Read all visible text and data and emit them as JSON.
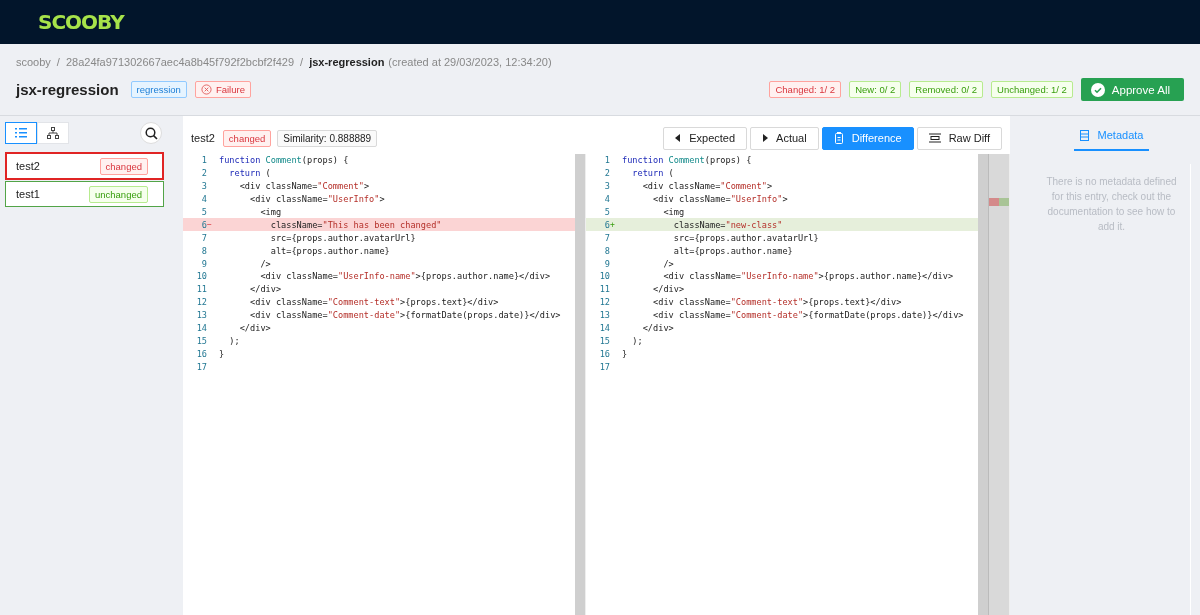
{
  "logo": "SCOOBY",
  "breadcrumb": {
    "separator": "/",
    "items": [
      "scooby",
      "28a24fa971302667aec4a8b45f792f2bcbf2f429",
      "jsx-regression"
    ],
    "created": "(created at 29/03/2023, 12:34:20)"
  },
  "title": "jsx-regression",
  "type_tag": "regression",
  "status_tag": "Failure",
  "counters": [
    {
      "kind": "changed",
      "label": "Changed: 1/ 2"
    },
    {
      "kind": "other",
      "label": "New: 0/ 2"
    },
    {
      "kind": "other",
      "label": "Removed: 0/ 2"
    },
    {
      "kind": "other",
      "label": "Unchanged: 1/ 2"
    }
  ],
  "approve_button": "Approve All",
  "view_toggles": [
    {
      "kind": "list",
      "selected": true
    },
    {
      "kind": "tree",
      "selected": false
    }
  ],
  "entries": [
    {
      "name": "test2",
      "status": "changed",
      "selected": true
    },
    {
      "name": "test1",
      "status": "unchanged",
      "selected": false
    }
  ],
  "diff": {
    "name": "test2",
    "status": "changed",
    "similarity": "Similarity: 0.888889",
    "tabs": [
      {
        "kind": "expected",
        "label": "Expected",
        "selected": false
      },
      {
        "kind": "actual",
        "label": "Actual",
        "selected": false
      },
      {
        "kind": "difference",
        "label": "Difference",
        "selected": true
      },
      {
        "kind": "raw",
        "label": "Raw Diff",
        "selected": false
      }
    ],
    "panes": [
      {
        "kind": "removed",
        "lines": [
          {
            "number": "1",
            "changed": false,
            "tokens": [
              {
                "kind": "kw",
                "text": "function "
              },
              {
                "kind": "fn",
                "text": "Comment"
              },
              {
                "kind": "plain",
                "text": "(props) {"
              }
            ]
          },
          {
            "number": "2",
            "changed": false,
            "tokens": [
              {
                "kind": "kw",
                "text": "  return "
              },
              {
                "kind": "plain",
                "text": "("
              }
            ]
          },
          {
            "number": "3",
            "changed": false,
            "tokens": [
              {
                "kind": "plain",
                "text": "    <div className="
              },
              {
                "kind": "str",
                "text": "\"Comment\""
              },
              {
                "kind": "plain",
                "text": ">"
              }
            ]
          },
          {
            "number": "4",
            "changed": false,
            "tokens": [
              {
                "kind": "plain",
                "text": "      <div className="
              },
              {
                "kind": "str",
                "text": "\"UserInfo\""
              },
              {
                "kind": "plain",
                "text": ">"
              }
            ]
          },
          {
            "number": "5",
            "changed": false,
            "tokens": [
              {
                "kind": "plain",
                "text": "        <img"
              }
            ]
          },
          {
            "number": "6",
            "changed": true,
            "marker": "−",
            "tokens": [
              {
                "kind": "plain",
                "text": "          className="
              },
              {
                "kind": "str",
                "text": "\"This has been changed\""
              }
            ]
          },
          {
            "number": "7",
            "changed": false,
            "tokens": [
              {
                "kind": "plain",
                "text": "          src={props.author.avatarUrl}"
              }
            ]
          },
          {
            "number": "8",
            "changed": false,
            "tokens": [
              {
                "kind": "plain",
                "text": "          alt={props.author.name}"
              }
            ]
          },
          {
            "number": "9",
            "changed": false,
            "tokens": [
              {
                "kind": "plain",
                "text": "        />"
              }
            ]
          },
          {
            "number": "10",
            "changed": false,
            "tokens": [
              {
                "kind": "plain",
                "text": "        <div className="
              },
              {
                "kind": "str",
                "text": "\"UserInfo-name\""
              },
              {
                "kind": "plain",
                "text": ">{props.author.name}</div>"
              }
            ]
          },
          {
            "number": "11",
            "changed": false,
            "tokens": [
              {
                "kind": "plain",
                "text": "      </div>"
              }
            ]
          },
          {
            "number": "12",
            "changed": false,
            "tokens": [
              {
                "kind": "plain",
                "text": "      <div className="
              },
              {
                "kind": "str",
                "text": "\"Comment-text\""
              },
              {
                "kind": "plain",
                "text": ">{props.text}</div>"
              }
            ]
          },
          {
            "number": "13",
            "changed": false,
            "tokens": [
              {
                "kind": "plain",
                "text": "      <div className="
              },
              {
                "kind": "str",
                "text": "\"Comment-date\""
              },
              {
                "kind": "plain",
                "text": ">{formatDate(props.date)}</div>"
              }
            ]
          },
          {
            "number": "14",
            "changed": false,
            "tokens": [
              {
                "kind": "plain",
                "text": "    </div>"
              }
            ]
          },
          {
            "number": "15",
            "changed": false,
            "tokens": [
              {
                "kind": "plain",
                "text": "  );"
              }
            ]
          },
          {
            "number": "16",
            "changed": false,
            "tokens": [
              {
                "kind": "plain",
                "text": "}"
              }
            ]
          },
          {
            "number": "17",
            "changed": false
          }
        ]
      },
      {
        "kind": "added",
        "lines": [
          {
            "number": "1",
            "changed": false,
            "tokens": [
              {
                "kind": "kw",
                "text": "function "
              },
              {
                "kind": "fn",
                "text": "Comment"
              },
              {
                "kind": "plain",
                "text": "(props) {"
              }
            ]
          },
          {
            "number": "2",
            "changed": false,
            "tokens": [
              {
                "kind": "kw",
                "text": "  return "
              },
              {
                "kind": "plain",
                "text": "("
              }
            ]
          },
          {
            "number": "3",
            "changed": false,
            "tokens": [
              {
                "kind": "plain",
                "text": "    <div className="
              },
              {
                "kind": "str",
                "text": "\"Comment\""
              },
              {
                "kind": "plain",
                "text": ">"
              }
            ]
          },
          {
            "number": "4",
            "changed": false,
            "tokens": [
              {
                "kind": "plain",
                "text": "      <div className="
              },
              {
                "kind": "str",
                "text": "\"UserInfo\""
              },
              {
                "kind": "plain",
                "text": ">"
              }
            ]
          },
          {
            "number": "5",
            "changed": false,
            "tokens": [
              {
                "kind": "plain",
                "text": "        <img"
              }
            ]
          },
          {
            "number": "6",
            "changed": true,
            "marker": "+",
            "tokens": [
              {
                "kind": "plain",
                "text": "          className="
              },
              {
                "kind": "str",
                "text": "\"new-class\""
              }
            ]
          },
          {
            "number": "7",
            "changed": false,
            "tokens": [
              {
                "kind": "plain",
                "text": "          src={props.author.avatarUrl}"
              }
            ]
          },
          {
            "number": "8",
            "changed": false,
            "tokens": [
              {
                "kind": "plain",
                "text": "          alt={props.author.name}"
              }
            ]
          },
          {
            "number": "9",
            "changed": false,
            "tokens": [
              {
                "kind": "plain",
                "text": "        />"
              }
            ]
          },
          {
            "number": "10",
            "changed": false,
            "tokens": [
              {
                "kind": "plain",
                "text": "        <div className="
              },
              {
                "kind": "str",
                "text": "\"UserInfo-name\""
              },
              {
                "kind": "plain",
                "text": ">{props.author.name}</div>"
              }
            ]
          },
          {
            "number": "11",
            "changed": false,
            "tokens": [
              {
                "kind": "plain",
                "text": "      </div>"
              }
            ]
          },
          {
            "number": "12",
            "changed": false,
            "tokens": [
              {
                "kind": "plain",
                "text": "      <div className="
              },
              {
                "kind": "str",
                "text": "\"Comment-text\""
              },
              {
                "kind": "plain",
                "text": ">{props.text}</div>"
              }
            ]
          },
          {
            "number": "13",
            "changed": false,
            "tokens": [
              {
                "kind": "plain",
                "text": "      <div className="
              },
              {
                "kind": "str",
                "text": "\"Comment-date\""
              },
              {
                "kind": "plain",
                "text": ">{formatDate(props.date)}</div>"
              }
            ]
          },
          {
            "number": "14",
            "changed": false,
            "tokens": [
              {
                "kind": "plain",
                "text": "    </div>"
              }
            ]
          },
          {
            "number": "15",
            "changed": false,
            "tokens": [
              {
                "kind": "plain",
                "text": "  );"
              }
            ]
          },
          {
            "number": "16",
            "changed": false,
            "tokens": [
              {
                "kind": "plain",
                "text": "}"
              }
            ]
          },
          {
            "number": "17",
            "changed": false
          }
        ]
      }
    ]
  },
  "metadata": {
    "tab": "Metadata",
    "message": "There is no metadata defined for this entry, check out the documentation to see how to add it."
  }
}
